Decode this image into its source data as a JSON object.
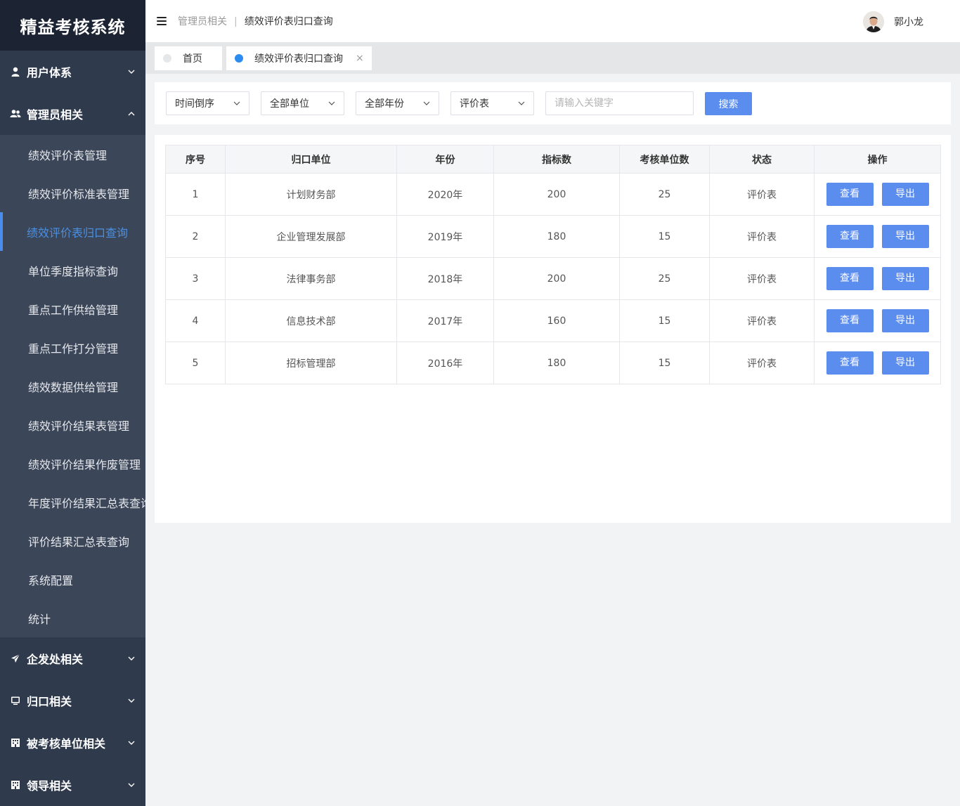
{
  "app": {
    "title": "精益考核系统"
  },
  "sidebar": {
    "groups": [
      {
        "label": "用户体系",
        "icon": "user-icon",
        "expanded": false
      },
      {
        "label": "管理员相关",
        "icon": "users-icon",
        "expanded": true,
        "items": [
          "绩效评价表管理",
          "绩效评价标准表管理",
          "绩效评价表归口查询",
          "单位季度指标查询",
          "重点工作供给管理",
          "重点工作打分管理",
          "绩效数据供给管理",
          "绩效评价结果表管理",
          "绩效评价结果作废管理",
          "年度评价结果汇总表查询",
          "评价结果汇总表查询",
          "系统配置",
          "统计"
        ],
        "active_item": "绩效评价表归口查询"
      },
      {
        "label": "企发处相关",
        "icon": "send-icon",
        "expanded": false
      },
      {
        "label": "归口相关",
        "icon": "monitor-icon",
        "expanded": false
      },
      {
        "label": "被考核单位相关",
        "icon": "building-icon",
        "expanded": false
      },
      {
        "label": "领导相关",
        "icon": "building-icon",
        "expanded": false
      }
    ]
  },
  "header": {
    "breadcrumb_parent": "管理员相关",
    "breadcrumb_separator": "|",
    "breadcrumb_current": "绩效评价表归口查询",
    "user_name": "郭小龙"
  },
  "tabs": [
    {
      "label": "首页",
      "active": false
    },
    {
      "label": "绩效评价表归口查询",
      "active": true,
      "close": "×"
    }
  ],
  "filters": {
    "sort": "时间倒序",
    "unit": "全部单位",
    "year": "全部年份",
    "type": "评价表",
    "search_placeholder": "请输入关键字",
    "search_value": "",
    "search_button": "搜索"
  },
  "table": {
    "columns": [
      "序号",
      "归口单位",
      "年份",
      "指标数",
      "考核单位数",
      "状态",
      "操作"
    ],
    "rows": [
      {
        "index": "1",
        "unit": "计划财务部",
        "year": "2020年",
        "indicators": "200",
        "units": "25",
        "status": "评价表"
      },
      {
        "index": "2",
        "unit": "企业管理发展部",
        "year": "2019年",
        "indicators": "180",
        "units": "15",
        "status": "评价表"
      },
      {
        "index": "3",
        "unit": "法律事务部",
        "year": "2018年",
        "indicators": "200",
        "units": "25",
        "status": "评价表"
      },
      {
        "index": "4",
        "unit": "信息技术部",
        "year": "2017年",
        "indicators": "160",
        "units": "15",
        "status": "评价表"
      },
      {
        "index": "5",
        "unit": "招标管理部",
        "year": "2016年",
        "indicators": "180",
        "units": "15",
        "status": "评价表"
      }
    ],
    "actions": {
      "view": "查看",
      "export": "导出"
    }
  },
  "colors": {
    "sidebar_bg": "#2f3a4d",
    "logo_bg": "#1c2433",
    "accent": "#5b8def",
    "active_text": "#4a90e2"
  }
}
